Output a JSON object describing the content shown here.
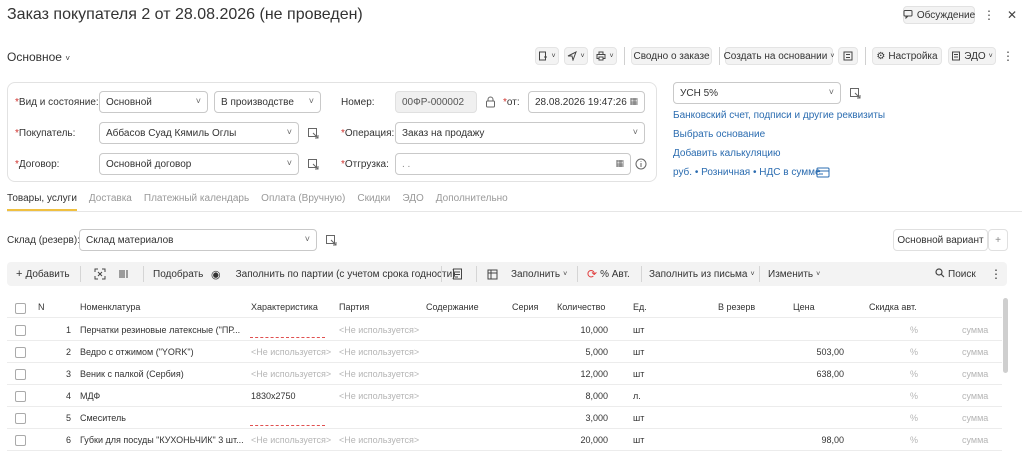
{
  "header": {
    "title": "Заказ покупателя 2 от 28.08.2026 (не проведен)",
    "discussion_label": "Обсуждение",
    "more_icon": "more-vertical-icon"
  },
  "toolbar": {
    "section_title": "Основное",
    "summary_label": "Сводно о заказе",
    "create_based_label": "Создать на основании",
    "settings_label": "Настройка",
    "edo_label": "ЭДО"
  },
  "form": {
    "kind_state_label": "Вид и состояние:",
    "kind_value": "Основной",
    "state_value": "В производстве",
    "buyer_label": "Покупатель:",
    "buyer_value": "Аббасов Суад Кямиль Оглы",
    "contract_label": "Договор:",
    "contract_value": "Основной договор",
    "number_label": "Номер:",
    "number_value": "00ФР-000002",
    "from_label": "от:",
    "date_value": "28.08.2026 19:47:26",
    "operation_label": "Операция:",
    "operation_value": "Заказ на продажу",
    "shipment_label": "Отгрузка:",
    "shipment_value": ". .",
    "tax_value": "УСН 5%",
    "link_bank": "Банковский счет, подписи и другие реквизиты",
    "link_basis": "Выбрать основание",
    "link_calc": "Добавить калькуляцию",
    "link_price": "руб. • Розничная • НДС в сумме"
  },
  "tabs": [
    "Товары, услуги",
    "Доставка",
    "Платежный календарь",
    "Оплата (Вручную)",
    "Скидки",
    "ЭДО",
    "Дополнительно"
  ],
  "warehouse": {
    "label": "Склад (резерв):",
    "value": "Склад материалов",
    "variant_label": "Основной вариант",
    "plus": "+"
  },
  "items_toolbar": {
    "add": "Добавить",
    "pick": "Подобрать",
    "fill_by_batch": "Заполнить по партии (с учетом срока годности)",
    "fill": "Заполнить",
    "percent_auto": "% Авт.",
    "fill_from_letter": "Заполнить из письма",
    "change": "Изменить",
    "search": "Поиск"
  },
  "table": {
    "columns": {
      "n": "N",
      "nomenclature": "Номенклатура",
      "characteristic": "Характеристика",
      "batch": "Партия",
      "content": "Содержание",
      "series": "Серия",
      "quantity": "Количество",
      "unit": "Ед.",
      "reserve": "В резерв",
      "price": "Цена",
      "discount": "Скидка авт."
    },
    "not_used": "<Не используется>",
    "percent": "%",
    "sum_placeholder": "сумма",
    "rows": [
      {
        "n": "1",
        "name": "Перчатки резиновые латексные (\"ПР...",
        "characteristic": "",
        "batch": "<Не используется>",
        "quantity": "10,000",
        "unit": "шт",
        "price": ""
      },
      {
        "n": "2",
        "name": "Ведро с отжимом (\"YORK\")",
        "characteristic": "<Не используется>",
        "batch": "<Не используется>",
        "quantity": "5,000",
        "unit": "шт",
        "price": "503,00"
      },
      {
        "n": "3",
        "name": "Веник с палкой (Сербия)",
        "characteristic": "<Не используется>",
        "batch": "<Не используется>",
        "quantity": "12,000",
        "unit": "шт",
        "price": "638,00"
      },
      {
        "n": "4",
        "name": "МДФ",
        "characteristic": "1830x2750",
        "batch": "<Не используется>",
        "quantity": "8,000",
        "unit": "л.",
        "price": ""
      },
      {
        "n": "5",
        "name": "Смеситель",
        "characteristic": "",
        "batch": "",
        "quantity": "3,000",
        "unit": "шт",
        "price": ""
      },
      {
        "n": "6",
        "name": "Губки для посуды \"КУХОНЬЧИК\" 3 шт...",
        "characteristic": "<Не используется>",
        "batch": "<Не используется>",
        "quantity": "20,000",
        "unit": "шт",
        "price": "98,00"
      }
    ]
  },
  "colors": {
    "accent_tab": "#f0c040",
    "link": "#2b6cb0",
    "required": "#d0312d",
    "refresh": "#e04040"
  }
}
